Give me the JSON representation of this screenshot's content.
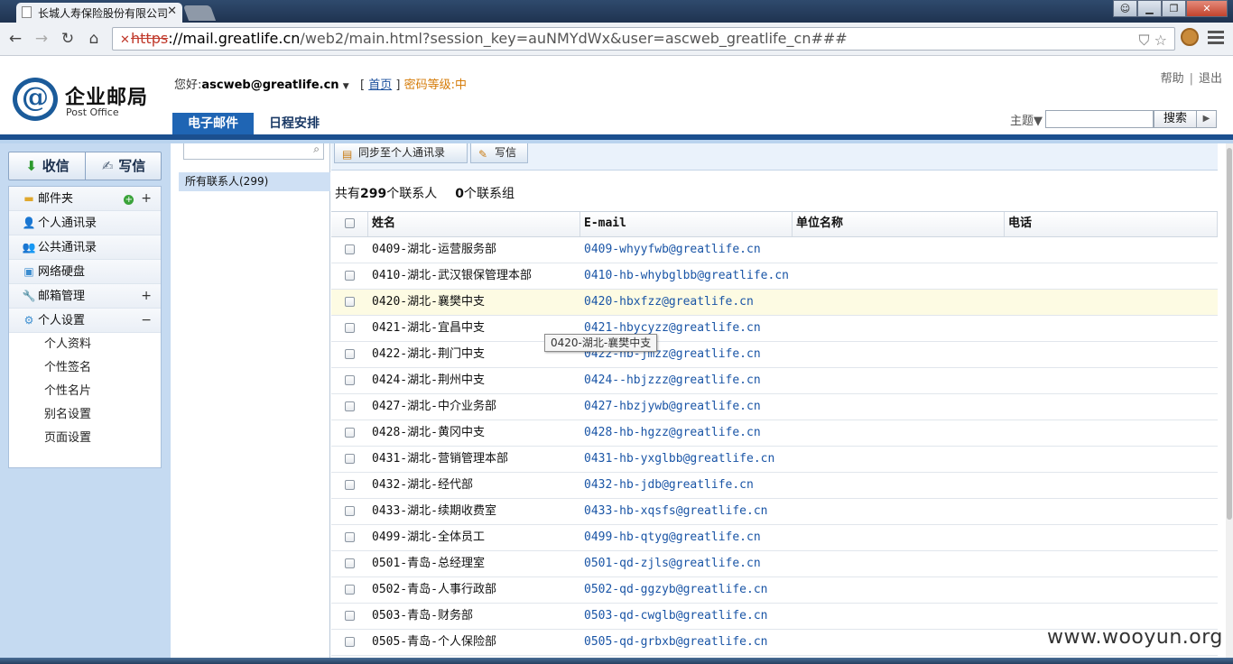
{
  "browser": {
    "tab_title": "长城人寿保险股份有限公司",
    "url_scheme": "https",
    "url_host": "://mail.greatlife.cn",
    "url_rest": "/web2/main.html?session_key=auNMYdWx&user=ascweb_greatlife_cn###"
  },
  "header": {
    "logo_title": "企业邮局",
    "logo_sub": "Post Office",
    "greeting": "您好:",
    "user": "ascweb@greatlife.cn",
    "home_link": "首页",
    "password_level": "密码等级:中",
    "help": "帮助",
    "logout": "退出",
    "tabs": [
      {
        "label": "电子邮件"
      },
      {
        "label": "日程安排"
      }
    ],
    "theme_label": "主题▼",
    "search_button": "搜索"
  },
  "sidebar": {
    "receive": "收信",
    "compose": "写信",
    "items": [
      {
        "label": "邮件夹"
      },
      {
        "label": "个人通讯录"
      },
      {
        "label": "公共通讯录"
      },
      {
        "label": "网络硬盘"
      },
      {
        "label": "邮箱管理"
      },
      {
        "label": "个人设置"
      }
    ],
    "sub_items": [
      {
        "label": "个人资料"
      },
      {
        "label": "个性签名"
      },
      {
        "label": "个性名片"
      },
      {
        "label": "别名设置"
      },
      {
        "label": "页面设置"
      }
    ]
  },
  "groups": {
    "all_contacts": "所有联系人(299)"
  },
  "toolbar": {
    "sync_label": "同步至个人通讯录",
    "compose_label": "写信"
  },
  "summary": {
    "prefix": "共有",
    "contact_count": "299",
    "contact_suffix": "个联系人",
    "group_count": "0",
    "group_suffix": "个联系组"
  },
  "table": {
    "headers": {
      "name": "姓名",
      "email": "E-mail",
      "unit": "单位名称",
      "phone": "电话"
    },
    "rows": [
      {
        "name": "0409-湖北-运营服务部",
        "email": "0409-whyyfwb@greatlife.cn"
      },
      {
        "name": "0410-湖北-武汉银保管理本部",
        "email": "0410-hb-whybglbb@greatlife.cn"
      },
      {
        "name": "0420-湖北-襄樊中支",
        "email": "0420-hbxfzz@greatlife.cn"
      },
      {
        "name": "0421-湖北-宜昌中支",
        "email": "0421-hbycyzz@greatlife.cn"
      },
      {
        "name": "0422-湖北-荆门中支",
        "email": "0422-hb-jmzz@greatlife.cn"
      },
      {
        "name": "0424-湖北-荆州中支",
        "email": "0424--hbjzzz@greatlife.cn"
      },
      {
        "name": "0427-湖北-中介业务部",
        "email": "0427-hbzjywb@greatlife.cn"
      },
      {
        "name": "0428-湖北-黄冈中支",
        "email": "0428-hb-hgzz@greatlife.cn"
      },
      {
        "name": "0431-湖北-营销管理本部",
        "email": "0431-hb-yxglbb@greatlife.cn"
      },
      {
        "name": "0432-湖北-经代部",
        "email": "0432-hb-jdb@greatlife.cn"
      },
      {
        "name": "0433-湖北-续期收费室",
        "email": "0433-hb-xqsfs@greatlife.cn"
      },
      {
        "name": "0499-湖北-全体员工",
        "email": "0499-hb-qtyg@greatlife.cn"
      },
      {
        "name": "0501-青岛-总经理室",
        "email": "0501-qd-zjls@greatlife.cn"
      },
      {
        "name": "0502-青岛-人事行政部",
        "email": "0502-qd-ggzyb@greatlife.cn"
      },
      {
        "name": "0503-青岛-财务部",
        "email": "0503-qd-cwglb@greatlife.cn"
      },
      {
        "name": "0505-青岛-个人保险部",
        "email": "0505-qd-grbxb@greatlife.cn"
      }
    ]
  },
  "tooltip": "0420-湖北-襄樊中支",
  "watermark": "www.wooyun.org",
  "colors": {
    "accent": "#1f65b4",
    "header_rule": "#1b4f8f",
    "sidebar_bg": "#c5daf1",
    "link": "#1a55a6",
    "warning": "#d57b08"
  }
}
